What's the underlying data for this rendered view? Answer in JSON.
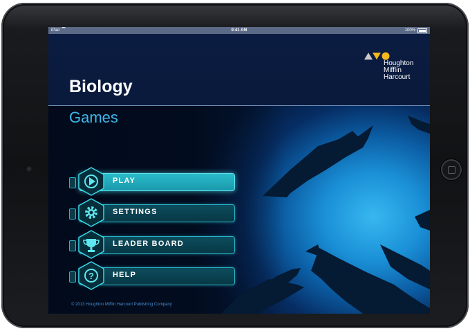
{
  "status_bar": {
    "carrier": "iPad",
    "time": "9:41 AM",
    "battery": "100%"
  },
  "logo": {
    "line1": "Houghton",
    "line2": "Mifflin",
    "line3": "Harcourt"
  },
  "title": "Biology",
  "subtitle": "Games",
  "menu": [
    {
      "label": "PLAY",
      "icon": "play-icon"
    },
    {
      "label": "SETTINGS",
      "icon": "gear-icon"
    },
    {
      "label": "LEADER BOARD",
      "icon": "trophy-icon"
    },
    {
      "label": "HELP",
      "icon": "help-icon"
    }
  ],
  "copyright": "© 2013 Houghton Mifflin Harcourt Publishing Company",
  "colors": {
    "accent": "#2ab3c8",
    "active": "#2abcc8",
    "title_blue": "#3db8ec",
    "logo_yellow": "#f5b820"
  }
}
